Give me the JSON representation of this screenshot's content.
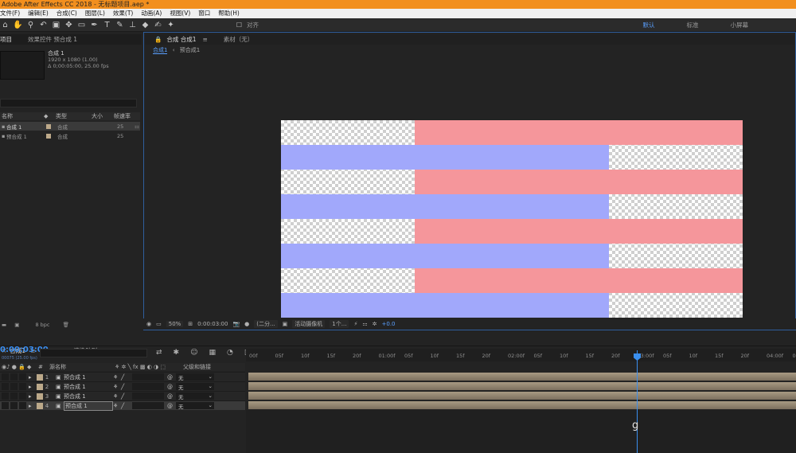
{
  "titlebar": {
    "text": "Adobe After Effects CC 2018 - 无标题项目.aep *"
  },
  "menu": [
    "文件(F)",
    "编辑(E)",
    "合成(C)",
    "图层(L)",
    "效果(T)",
    "动画(A)",
    "视图(V)",
    "窗口",
    "帮助(H)"
  ],
  "toolbar": {
    "tools": [
      "home-icon",
      "hand-icon",
      "zoom-icon",
      "rotate-icon",
      "camera-icon",
      "pan-behind-icon",
      "rect-icon",
      "pen-icon",
      "text-icon",
      "brush-icon",
      "clone-icon",
      "eraser-icon",
      "roto-icon",
      "puppet-icon"
    ],
    "align_label": "对齐",
    "workspaces": [
      "默认",
      "标准",
      "小屏幕"
    ]
  },
  "project_panel": {
    "tab1": "项目",
    "tab2": "效果控件 预合成 1",
    "comp_name": "合成 1",
    "comp_info1": "1920 x 1080 (1.00)",
    "comp_info2": "Δ 0;00:05:00, 25.00 fps",
    "col_name": "名称",
    "col_type": "类型",
    "col_size": "大小",
    "col_fps": "帧速率",
    "items": [
      {
        "name": "合成 1",
        "type": "合成",
        "fps": "25"
      },
      {
        "name": "预合成 1",
        "type": "合成",
        "fps": "25"
      }
    ],
    "bpc": "8 bpc"
  },
  "viewer": {
    "tab_comp": "合成 合成1",
    "tab_footage": "素材（无）",
    "breadcrumb1": "合成1",
    "breadcrumb2": "预合成1",
    "zoom": "50%",
    "timecode": "0:00:03:00",
    "resolution": "(二分...",
    "camera": "活动摄像机",
    "views": "1个...",
    "exposure": "+0.0",
    "bands": [
      {
        "left_color": "checker",
        "right_color": "#f5969b",
        "split": 0.29
      },
      {
        "left_color": "#a1a8fb",
        "right_color": "checker",
        "split": 0.71
      },
      {
        "left_color": "checker",
        "right_color": "#f5969b",
        "split": 0.29
      },
      {
        "left_color": "#a1a8fb",
        "right_color": "checker",
        "split": 0.71
      },
      {
        "left_color": "checker",
        "right_color": "#f5969b",
        "split": 0.29
      },
      {
        "left_color": "#a1a8fb",
        "right_color": "checker",
        "split": 0.71
      },
      {
        "left_color": "checker",
        "right_color": "#f5969b",
        "split": 0.29
      },
      {
        "left_color": "#a1a8fb",
        "right_color": "checker",
        "split": 0.71
      }
    ]
  },
  "timeline": {
    "tab1": "合成1",
    "tab2": "渲染队列",
    "timecode": "0:00:03:00",
    "timecode_sub": "00075 (25.00 fps)",
    "col_layer": "源名称",
    "col_parent": "父级和链接",
    "ruler": [
      "00f",
      "05f",
      "10f",
      "15f",
      "20f",
      "01:00f",
      "05f",
      "10f",
      "15f",
      "20f",
      "02:00f",
      "05f",
      "10f",
      "15f",
      "20f",
      "03:00f",
      "05f",
      "10f",
      "15f",
      "20f",
      "04:00f",
      "05f"
    ],
    "layers": [
      {
        "num": "1",
        "name": "预合成 1",
        "parent": "无"
      },
      {
        "num": "2",
        "name": "预合成 1",
        "parent": "无"
      },
      {
        "num": "3",
        "name": "预合成 1",
        "parent": "无"
      },
      {
        "num": "4",
        "name": "预合成 1",
        "parent": "无"
      }
    ],
    "playhead_label": "g"
  }
}
